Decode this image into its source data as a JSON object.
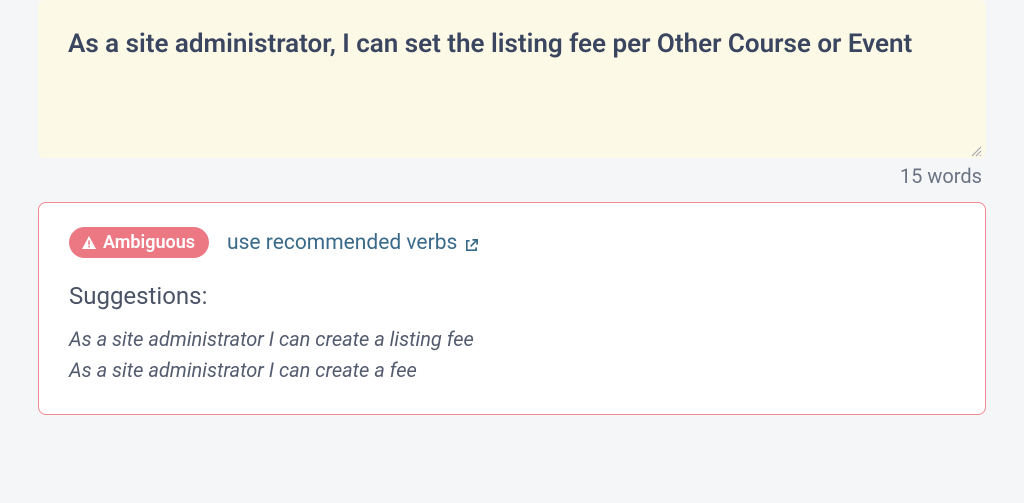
{
  "input": {
    "text": "As a site administrator, I can set the listing fee per Other Course or Event"
  },
  "word_count": "15 words",
  "panel": {
    "badge_label": "Ambiguous",
    "link_label": "use recommended verbs",
    "suggestions_title": "Suggestions:",
    "suggestions": [
      "As a site administrator I can create a listing fee",
      "As a site administrator I can create a fee"
    ]
  }
}
